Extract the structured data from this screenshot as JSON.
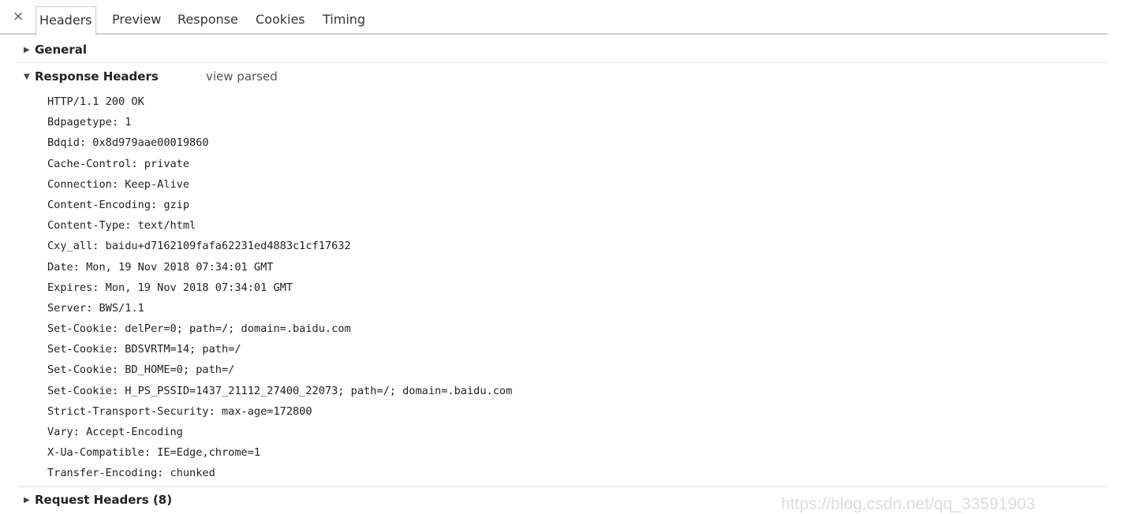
{
  "tabs": {
    "close_glyph": "×",
    "items": [
      {
        "label": "Headers",
        "active": true
      },
      {
        "label": "Preview",
        "active": false
      },
      {
        "label": "Response",
        "active": false
      },
      {
        "label": "Cookies",
        "active": false
      },
      {
        "label": "Timing",
        "active": false
      }
    ]
  },
  "sections": {
    "general": {
      "title": "General",
      "expanded": false,
      "arrow_icon": "triangle-right-icon"
    },
    "response_headers": {
      "title": "Response Headers",
      "expanded": true,
      "arrow_icon": "triangle-down-icon",
      "view_parsed_label": "view parsed",
      "lines": [
        "HTTP/1.1 200 OK",
        "Bdpagetype: 1",
        "Bdqid: 0x8d979aae00019860",
        "Cache-Control: private",
        "Connection: Keep-Alive",
        "Content-Encoding: gzip",
        "Content-Type: text/html",
        "Cxy_all: baidu+d7162109fafa62231ed4883c1cf17632",
        "Date: Mon, 19 Nov 2018 07:34:01 GMT",
        "Expires: Mon, 19 Nov 2018 07:34:01 GMT",
        "Server: BWS/1.1",
        "Set-Cookie: delPer=0; path=/; domain=.baidu.com",
        "Set-Cookie: BDSVRTM=14; path=/",
        "Set-Cookie: BD_HOME=0; path=/",
        "Set-Cookie: H_PS_PSSID=1437_21112_27400_22073; path=/; domain=.baidu.com",
        "Strict-Transport-Security: max-age=172800",
        "Vary: Accept-Encoding",
        "X-Ua-Compatible: IE=Edge,chrome=1",
        "Transfer-Encoding: chunked"
      ]
    },
    "request_headers": {
      "title": "Request Headers (8)",
      "expanded": false,
      "arrow_icon": "triangle-right-icon"
    }
  },
  "watermark": "https://blog.csdn.net/qq_33591903",
  "colors": {
    "text": "#222222",
    "divider": "#e6e6e6",
    "tab_border": "#cccccc",
    "muted": "#555555",
    "watermark": "#dddddd"
  }
}
